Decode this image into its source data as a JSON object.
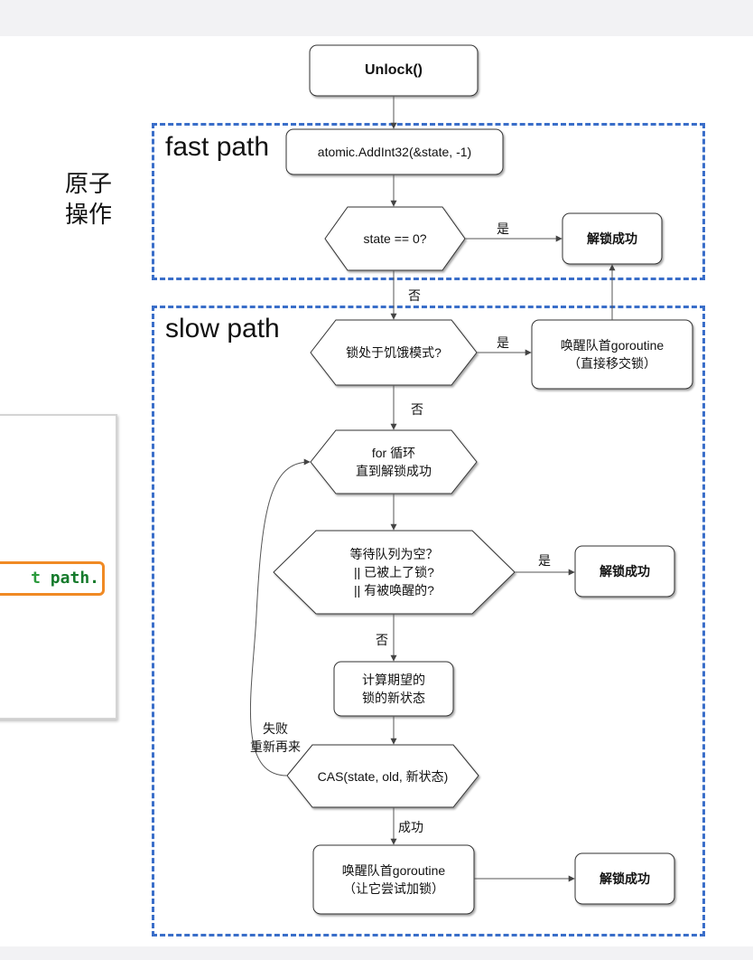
{
  "regions": {
    "fast_path_label": "fast path",
    "slow_path_label": "slow path",
    "atomic_label_line1": "原子",
    "atomic_label_line2": "操作"
  },
  "code_snippet": {
    "text_main": "t",
    "text_rest": " path."
  },
  "nodes": {
    "unlock": "Unlock()",
    "add_int": "atomic.AddInt32(&state, -1)",
    "state_zero": "state == 0?",
    "unlock_success_1": "解锁成功",
    "starving": "锁处于饥饿模式?",
    "wake_head_1_line1": "唤醒队首goroutine",
    "wake_head_1_line2": "（直接移交锁）",
    "for_loop_line1": "for 循环",
    "for_loop_line2": "直到解锁成功",
    "queue_check_line1": "等待队列为空？",
    "queue_check_line2": "|| 已被上了锁?",
    "queue_check_line3": "|| 有被唤醒的?",
    "unlock_success_2": "解锁成功",
    "compute_line1": "计算期望的",
    "compute_line2": "锁的新状态",
    "cas": "CAS(state, old, 新状态)",
    "wake_head_2_line1": "唤醒队首goroutine",
    "wake_head_2_line2": "（让它尝试加锁）",
    "unlock_success_3": "解锁成功"
  },
  "edges": {
    "yes_1": "是",
    "no_1": "否",
    "yes_2": "是",
    "no_2": "否",
    "yes_3": "是",
    "no_3": "否",
    "success": "成功",
    "fail_line1": "失败",
    "fail_line2": "重新再来"
  },
  "colors": {
    "region_border": "#3a6ec9",
    "highlight_border": "#f08a24",
    "code_green": "#157a2b"
  }
}
